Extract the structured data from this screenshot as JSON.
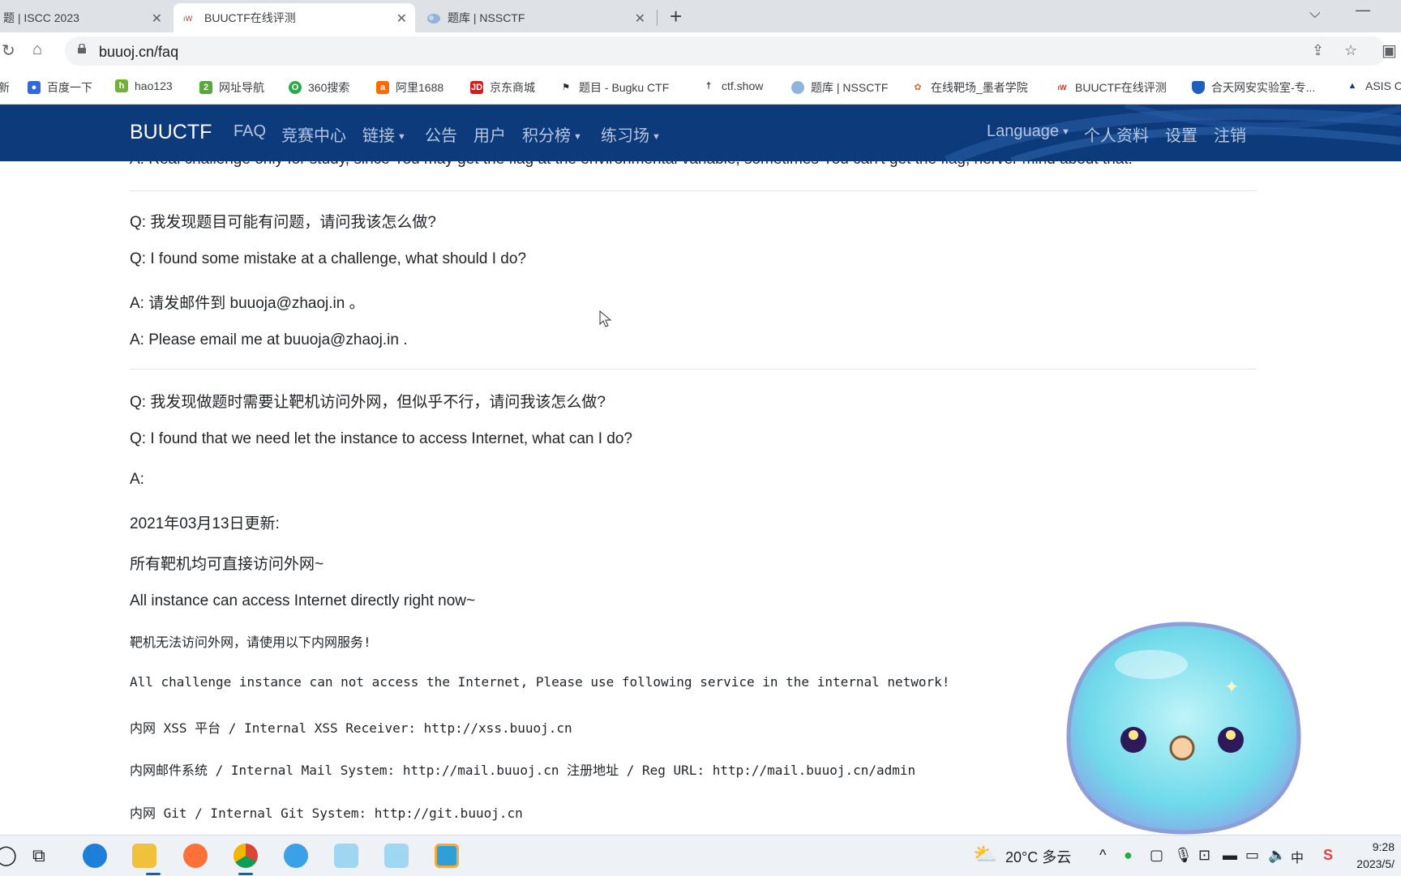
{
  "tabs": [
    {
      "label": "题 | ISCC 2023",
      "close": "✕"
    },
    {
      "label": "BUUCTF在线评测",
      "close": "✕"
    },
    {
      "label": "题库 | NSSCTF",
      "close": "✕"
    }
  ],
  "new_tab": "+",
  "address": {
    "url": "buuoj.cn/faq"
  },
  "bookmarks": [
    "新",
    "百度一下",
    "hao123",
    "网址导航",
    "360搜索",
    "阿里1688",
    "京东商城",
    "题目 - Bugku CTF",
    "ctf.show",
    "题库 | NSSCTF",
    "在线靶场_墨者学院",
    "BUUCTF在线评测",
    "合天网安实验室-专...",
    "ASIS C"
  ],
  "navbar": {
    "brand": "BUUCTF",
    "links": [
      "FAQ",
      "竞赛中心",
      "链接",
      "公告",
      "用户",
      "积分榜",
      "练习场"
    ],
    "right_links": [
      "Language",
      "个人资料",
      "设置",
      "注销"
    ]
  },
  "faq": {
    "partial_answer": "A: Real challenge only for study, since You may get the flag at the environmental variable, sometimes You can't get the flag, nerver mind about that.",
    "q2_cn": "Q: 我发现题目可能有问题，请问我该怎么做?",
    "q2_en": "Q: I found some mistake at a challenge, what should I do?",
    "a2_cn": "A: 请发邮件到 buuoja@zhaoj.in 。",
    "a2_en": "A: Please email me at buuoja@zhaoj.in .",
    "q3_cn": "Q: 我发现做题时需要让靶机访问外网，但似乎不行，请问我该怎么做?",
    "q3_en": "Q: I found that we need let the instance to access Internet, what can I do?",
    "a3_label": "A:",
    "update_date": "2021年03月13日更新:",
    "update_cn": "所有靶机均可直接访问外网~",
    "update_en": "All instance can access Internet directly right now~",
    "note_cn": "靶机无法访问外网，请使用以下内网服务!",
    "note_en": "All challenge instance can not access the Internet, Please use following service in the internal network!",
    "svc_xss": "内网 XSS 平台 / Internal XSS Receiver: http://xss.buuoj.cn",
    "svc_mail": "内网邮件系统 / Internal Mail System: http://mail.buuoj.cn 注册地址 / Reg URL: http://mail.buuoj.cn/admin",
    "svc_git": "内网 Git / Internal Git System: http://git.buuoj.cn"
  },
  "taskbar": {
    "weather": "20°C 多云",
    "time": "9:28",
    "date": "2023/5/"
  },
  "colors": {
    "navbar": "#0c3a7a",
    "tabbar": "#dee1e6"
  }
}
